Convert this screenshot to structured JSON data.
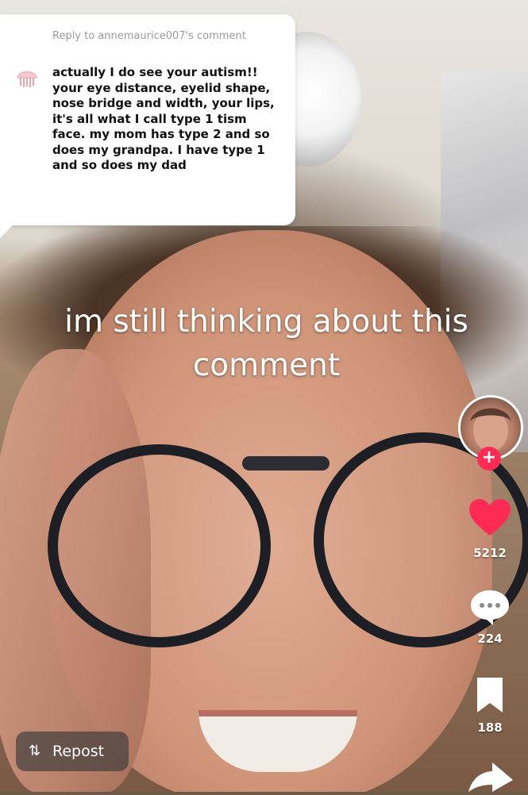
{
  "comment": {
    "reply_label": "Reply to annemaurice007's comment",
    "text": "actually I do see your autism!! your eye distance, eyelid shape, nose bridge and width, your lips, it's all what I call type 1 tism face. my mom has type 2 and so does my grandpa. I have type 1 and so does my dad",
    "avatar_icon": "jellyfish-icon"
  },
  "caption": "im still thinking about this comment",
  "sidebar": {
    "profile_icon": "profile-avatar",
    "follow_label": "+",
    "likes": "5212",
    "comments": "224",
    "saves": "188",
    "accent": "#fe2c55"
  },
  "repost": {
    "icon": "repost-icon",
    "label": "Repost"
  }
}
